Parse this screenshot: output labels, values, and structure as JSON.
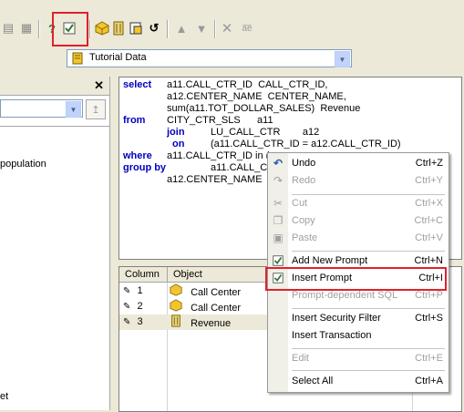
{
  "datasource": {
    "value": "Tutorial Data"
  },
  "sql": {
    "lines": [
      {
        "kw": "select",
        "text": "a11.CALL_CTR_ID  CALL_CTR_ID,"
      },
      {
        "kw": "",
        "text": "a12.CENTER_NAME  CENTER_NAME,"
      },
      {
        "kw": "",
        "text": "sum(a11.TOT_DOLLAR_SALES)  Revenue"
      },
      {
        "kw": "from",
        "text": "CITY_CTR_SLS      a11"
      },
      {
        "kw": "",
        "text": "LU_CALL_CTR        a12"
      },
      {
        "kw": "",
        "text": "(a11.CALL_CTR_ID = a12.CALL_CTR_ID)"
      },
      {
        "kw": "where",
        "text": "a11.CALL_CTR_ID in ("
      },
      {
        "kw": "group by",
        "text": "a11.CALL_C"
      },
      {
        "kw": "",
        "text": "a12.CENTER_NAME"
      }
    ],
    "join_kw": "join",
    "on_kw": "on"
  },
  "left_panel": {
    "item1": "population",
    "item2": "et"
  },
  "grid": {
    "headers": [
      "Column",
      "Object"
    ],
    "rows": [
      {
        "col": "1",
        "object": "Call Center"
      },
      {
        "col": "2",
        "object": "Call Center"
      },
      {
        "col": "3",
        "object": "Revenue"
      }
    ]
  },
  "context_menu": {
    "undo": {
      "label": "Undo",
      "shortcut": "Ctrl+Z"
    },
    "redo": {
      "label": "Redo",
      "shortcut": "Ctrl+Y"
    },
    "cut": {
      "label": "Cut",
      "shortcut": "Ctrl+X"
    },
    "copy": {
      "label": "Copy",
      "shortcut": "Ctrl+C"
    },
    "paste": {
      "label": "Paste",
      "shortcut": "Ctrl+V"
    },
    "add_prompt": {
      "label": "Add New Prompt",
      "shortcut": "Ctrl+N"
    },
    "insert_prompt": {
      "label": "Insert Prompt",
      "shortcut": "Ctrl+I"
    },
    "prompt_sql": {
      "label": "Prompt-dependent SQL",
      "shortcut": "Ctrl+P"
    },
    "security": {
      "label": "Insert Security Filter",
      "shortcut": "Ctrl+S"
    },
    "transaction": {
      "label": "Insert Transaction",
      "shortcut": ""
    },
    "edit": {
      "label": "Edit",
      "shortcut": "Ctrl+E"
    },
    "select_all": {
      "label": "Select All",
      "shortcut": "Ctrl+A"
    }
  },
  "colors": {
    "highlight": "#e0212b",
    "keyword": "#0000c0"
  }
}
